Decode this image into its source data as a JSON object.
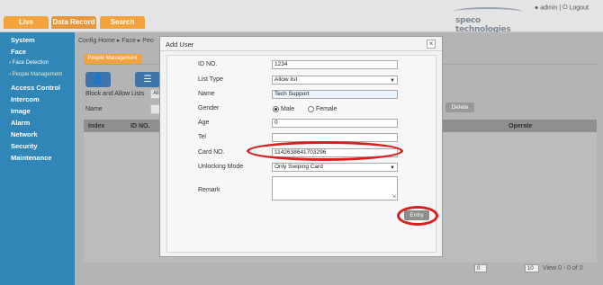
{
  "top_tabs": [
    "Live",
    "Data Record",
    "Search"
  ],
  "brand": "speco technologies",
  "user": {
    "name": "admin",
    "separator": "|",
    "logout": "Logout",
    "user_icon": "user-icon",
    "power_icon": "power-icon"
  },
  "sidebar": {
    "items": [
      {
        "label": "System"
      },
      {
        "label": "Face"
      },
      {
        "label": "Access Control"
      },
      {
        "label": "Intercom"
      },
      {
        "label": "Image"
      },
      {
        "label": "Alarm"
      },
      {
        "label": "Network"
      },
      {
        "label": "Security"
      },
      {
        "label": "Maintenance"
      }
    ],
    "subitems": [
      {
        "label": "Face Detection"
      },
      {
        "label": "People Management"
      }
    ]
  },
  "content": {
    "breadcrumb": [
      "Config Home",
      "Face",
      "Peo"
    ],
    "breadcrumb_sep": "▸",
    "tab": "People Management",
    "block_allow_label": "Block and Allow Lists",
    "filter_value": "All",
    "name_label": "Name",
    "delete_label": "Delete",
    "columns": [
      "Index",
      "ID NO.",
      "Operate"
    ],
    "pager": {
      "page": "0",
      "per_page": "10",
      "view": "View 0 - 0 of 0"
    }
  },
  "modal": {
    "title": "Add User",
    "close": "×",
    "fields": {
      "id_label": "ID NO.",
      "id_value": "1234",
      "list_type_label": "List Type",
      "list_type_value": "Allow list",
      "name_label": "Name",
      "name_value": "Tech Support",
      "gender_label": "Gender",
      "male": "Male",
      "female": "Female",
      "age_label": "Age",
      "age_value": "0",
      "tel_label": "Tel",
      "tel_value": "",
      "card_label": "Card NO.",
      "card_value": "1142638641703296",
      "unlock_label": "Unlocking Mode",
      "unlock_value": "Only Swiping Card",
      "remark_label": "Remark",
      "remark_value": ""
    },
    "entry": "Entry"
  },
  "colors": {
    "accent": "#f3a23c",
    "sidebar": "#2f86b7",
    "highlight": "#d91e1e"
  }
}
